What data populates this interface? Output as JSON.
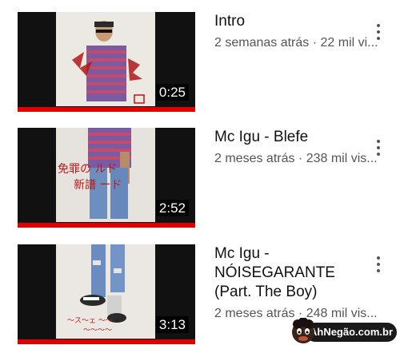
{
  "videos": [
    {
      "title": "Intro",
      "meta": "2 semanas atrás · 22 mil vi...",
      "duration": "0:25",
      "watched_fraction": 1.0
    },
    {
      "title": "Mc Igu - Blefe",
      "meta": "2 meses atrás · 238 mil vis...",
      "duration": "2:52",
      "watched_fraction": 1.0
    },
    {
      "title": "Mc Igu -\nNÓISEGARANTE\n(Part. The Boy)",
      "meta": "2 meses atrás · 248 mil vis...",
      "duration": "3:13",
      "watched_fraction": 1.0
    }
  ],
  "watermark": {
    "text": "AhNegão.com.br"
  },
  "colors": {
    "progress": "#e00000",
    "meta_text": "#555555",
    "title_text": "#111111"
  }
}
